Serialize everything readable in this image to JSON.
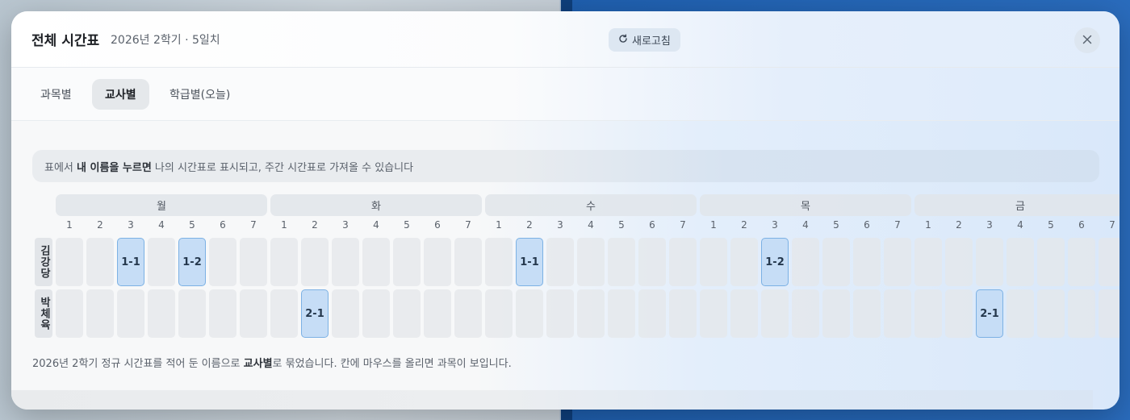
{
  "modal": {
    "title": "전체 시간표",
    "subtitle": "2026년 2학기 · 5일치",
    "refresh_label": "새로고침"
  },
  "tabs": [
    {
      "label": "과목별",
      "active": false
    },
    {
      "label": "교사별",
      "active": true
    },
    {
      "label": "학급별(오늘)",
      "active": false
    }
  ],
  "notice": {
    "prefix": "표에서 ",
    "bold": "내 이름을 누르면",
    "suffix": " 나의 시간표로 표시되고, 주간 시간표로 가져올 수 있습니다"
  },
  "schedule": {
    "days": [
      "월",
      "화",
      "수",
      "목",
      "금"
    ],
    "periods": [
      "1",
      "2",
      "3",
      "4",
      "5",
      "6",
      "7"
    ],
    "teachers": [
      {
        "name": "김강당",
        "entries": [
          {
            "day": 0,
            "period": 2,
            "label": "1-1"
          },
          {
            "day": 0,
            "period": 4,
            "label": "1-2"
          },
          {
            "day": 2,
            "period": 1,
            "label": "1-1"
          },
          {
            "day": 3,
            "period": 2,
            "label": "1-2"
          }
        ]
      },
      {
        "name": "박체육",
        "entries": [
          {
            "day": 1,
            "period": 1,
            "label": "2-1"
          },
          {
            "day": 4,
            "period": 2,
            "label": "2-1"
          }
        ]
      }
    ]
  },
  "footnote": {
    "prefix": "2026년 2학기 정규 시간표를 적어 둔 이름으로 ",
    "bold": "교사별",
    "suffix": "로 묶었습니다. 칸에 마우스를 올리면 과목이 보입니다."
  },
  "colors": {
    "cell_filled": "#c6ddf6",
    "cell_filled_border": "#7cb1e4",
    "cell_empty": "#e4e7ea"
  }
}
